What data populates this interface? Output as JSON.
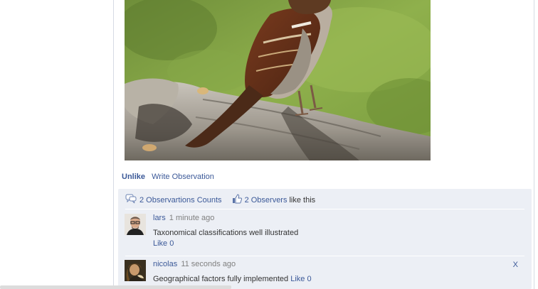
{
  "post": {
    "photo_alt": "sparrow-photo",
    "actions": {
      "unlike_label": "Unlike",
      "write_label": "Write Observation"
    }
  },
  "feedback": {
    "counts_label": "2 Observartions Counts",
    "observers_label": "2 Observers",
    "observers_suffix": "like this"
  },
  "comments": [
    {
      "author": "lars",
      "time": "1 minute ago",
      "text": "Taxonomical classifications well illustrated",
      "like_label": "Like 0"
    },
    {
      "author": "nicolas",
      "time": "11 seconds ago",
      "text": "Geographical factors fully implemented",
      "like_label": "Like 0",
      "close_label": "X"
    }
  ],
  "colors": {
    "link": "#3b5998",
    "panel_bg": "#eceff5",
    "muted_text": "#808080"
  },
  "icons": {
    "comments": "speech-bubbles-icon",
    "observers": "thumbs-up-icon"
  }
}
